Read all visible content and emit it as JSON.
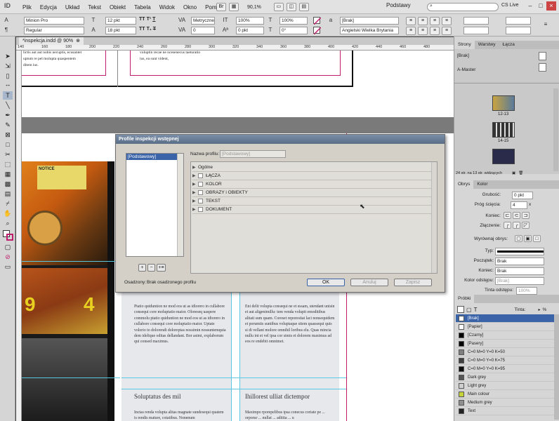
{
  "app": {
    "logo": "ID",
    "window_title": ""
  },
  "menubar": {
    "items": [
      "Plik",
      "Edycja",
      "Układ",
      "Tekst",
      "Obiekt",
      "Tabela",
      "Widok",
      "Okno",
      "Pomoc"
    ],
    "zoom": "90,1%",
    "workspace": "Podstawy",
    "cslive": "CS Live",
    "search_placeholder": ""
  },
  "control": {
    "font_family": "Minion Pro",
    "font_style": "Regular",
    "font_size": "12 pkt",
    "leading": "18 pkt",
    "kerning": "Metryczne",
    "tracking": "0",
    "scale_v": "100%",
    "scale_h": "100%",
    "baseline": "0 pkt",
    "skew": "0°",
    "char_style": "[Brak]",
    "language": "Angielski Wielka Brytania",
    "caps_labels": [
      "TT",
      "T¹",
      "T"
    ],
    "under_labels": [
      "TT",
      "T₁",
      "T"
    ]
  },
  "doc_tab": {
    "label": "*inspekcja.indd @ 90%",
    "close": "⊗"
  },
  "ruler": {
    "ticks": [
      "140",
      "160",
      "180",
      "200",
      "220",
      "240",
      "260",
      "280",
      "300",
      "320",
      "340",
      "360",
      "380",
      "400",
      "420",
      "440",
      "460",
      "480"
    ]
  },
  "page_text": {
    "top_left_lines": [
      "lictis aut aut nobis necuptis, ecusantet",
      "uptum re pel molupta quaspentem",
      "ditem ius."
    ],
    "top_right_lines": [
      "voluptin recae ne ncesenecus taeturatio",
      "ius, ea sunt vident,"
    ],
    "col1_body": "Ptatio quiduntion ne mod eos ut as idiorero in cullabore consequi core moluptatio maior. Oloreseq uaspere commolu ptatio quiduntion ne mod eos ut as idiorero in cullabore consequi core moluptatio maior. Uptate volorio to dolorendi doloreptas nossimin nossuntemquia dem idelique oditas dellandant. Bor asimi, explaborum qui consed maximus.",
    "col2_body": "Eni delit volupta consequi ne et essam, utendant unisin et aut aligenimillu: tem venda volupit emoditibus alitati sum quam. Coreset reporestiat laci nonsequidem et porumtis suntibus voluptaque sitem quassequi quis si di vellant molore omnihil loribus elu. Quas mincia nullu int et vel ipsa cor simis et dolorem maximus ad eos re endebit omnimet.",
    "col1_heading": "Soluptatus des mil",
    "col2_heading": "Ihillorest ulliat dictempor",
    "col1_tail": "Inctas renda volupta alitas magnate sundesequi quatem is rendis mature, cotatibus. Nonenum",
    "col2_tail": "Maximpo rporepelibus ipsa conecus coriate pe ... orporur ... nullat ... adiitia ... u",
    "photo_numbers": [
      "9",
      "4"
    ],
    "photo_sign": "NOTICE"
  },
  "dialog": {
    "title": "Profile inspekcji wstępnej",
    "profile_label": "Nazwa profilu:",
    "profile_value": "[Podstawowy]",
    "list_items": [
      "[Podstawowy]"
    ],
    "tree": [
      {
        "label": "Ogólne",
        "checkbox": false
      },
      {
        "label": "ŁĄCZA",
        "checkbox": true
      },
      {
        "label": "KOLOR",
        "checkbox": true
      },
      {
        "label": "OBRAZY i OBIEKTY",
        "checkbox": true
      },
      {
        "label": "TEKST",
        "checkbox": true
      },
      {
        "label": "DOKUMENT",
        "checkbox": true
      }
    ],
    "embedded_label": "Osadzony:",
    "embedded_value": "Brak osadzonego profilu",
    "ok": "OK",
    "cancel": "Anuluj",
    "save": "Zapisz",
    "bottom_icons": [
      "+",
      "−",
      "+≡"
    ]
  },
  "pages_panel": {
    "tabs": [
      "Strony",
      "Warstwy",
      "Łącza"
    ],
    "masters": [
      "[Brak]",
      "A-Master"
    ],
    "spreads": [
      "12-13",
      "14-15"
    ],
    "status": "24 str. na 13 str. widzących"
  },
  "stroke_panel": {
    "tabs": [
      "Obrys",
      "Kolor"
    ],
    "weight_label": "Grubość:",
    "weight": "0 pkt",
    "miter_label": "Próg ścięcia:",
    "miter": "4",
    "miter_x": "x",
    "cap_label": "Koniec:",
    "join_label": "Złączenie:",
    "align_label": "Wyrównaj obrys:",
    "type_label": "Typ:",
    "start_label": "Początek:",
    "start": "Brak",
    "end_label": "Koniec:",
    "end": "Brak",
    "gap_color_label": "Kolor odstępu:",
    "gap_color": "[Brak]",
    "gap_tint_label": "Tinta odstępu:",
    "gap_tint": "100%"
  },
  "swatches_panel": {
    "tab": "Próbki",
    "tint_label": "Tinta:",
    "tint_value": "",
    "percent": "%",
    "items": [
      {
        "name": "[Brak]",
        "color": "#ffffff",
        "selected": true
      },
      {
        "name": "[Papier]",
        "color": "#ffffff"
      },
      {
        "name": "[Czarny]",
        "color": "#000000"
      },
      {
        "name": "[Pasery]",
        "color": "#000000"
      },
      {
        "name": "C=0 M=0 Y=0 K=50",
        "color": "#808080"
      },
      {
        "name": "C=0 M=0 Y=0 K=75",
        "color": "#404040"
      },
      {
        "name": "C=0 M=0 Y=0 K=95",
        "color": "#0d0d0d"
      },
      {
        "name": "Dark grey",
        "color": "#555555"
      },
      {
        "name": "Light grey",
        "color": "#cfcfcf"
      },
      {
        "name": "Main colour",
        "color": "#c6d23a"
      },
      {
        "name": "Medium grey",
        "color": "#8f8f8f"
      },
      {
        "name": "Text",
        "color": "#222222"
      }
    ]
  },
  "colors": {
    "accent": "#c01d6e",
    "dialog_title": "#5a6e88",
    "selection": "#3a63a8"
  }
}
